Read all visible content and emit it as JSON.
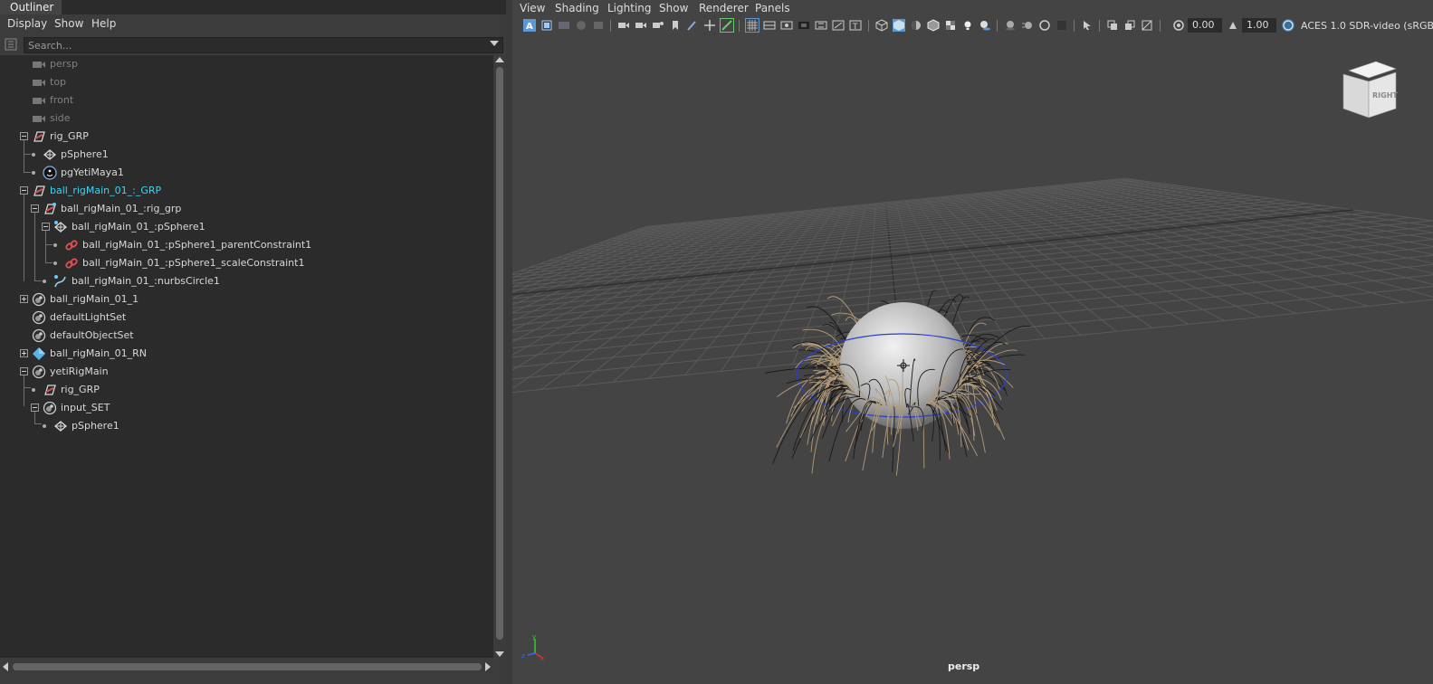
{
  "outliner": {
    "tab_label": "Outliner",
    "menus": [
      "Display",
      "Show",
      "Help"
    ],
    "search_placeholder": "Search...",
    "rows": [
      {
        "label": "persp",
        "icon": "camera-icon",
        "dim": true
      },
      {
        "label": "top",
        "icon": "camera-icon",
        "dim": true
      },
      {
        "label": "front",
        "icon": "camera-icon",
        "dim": true
      },
      {
        "label": "side",
        "icon": "camera-icon",
        "dim": true
      },
      {
        "label": "rig_GRP",
        "icon": "transform-group-icon"
      },
      {
        "label": "pSphere1",
        "icon": "mesh-icon"
      },
      {
        "label": "pgYetiMaya1",
        "icon": "yeti-node-icon"
      },
      {
        "label": "ball_rigMain_01_:_GRP",
        "icon": "transform-group-icon",
        "selected": true
      },
      {
        "label": "ball_rigMain_01_:rig_grp",
        "icon": "referenced-group-icon"
      },
      {
        "label": "ball_rigMain_01_:pSphere1",
        "icon": "mesh-icon"
      },
      {
        "label": "ball_rigMain_01_:pSphere1_parentConstraint1",
        "icon": "constraint-icon"
      },
      {
        "label": "ball_rigMain_01_:pSphere1_scaleConstraint1",
        "icon": "constraint-icon"
      },
      {
        "label": "ball_rigMain_01_:nurbsCircle1",
        "icon": "nurbs-curve-icon"
      },
      {
        "label": "ball_rigMain_01_1",
        "icon": "set-icon"
      },
      {
        "label": "defaultLightSet",
        "icon": "set-icon"
      },
      {
        "label": "defaultObjectSet",
        "icon": "set-icon"
      },
      {
        "label": "ball_rigMain_01_RN",
        "icon": "reference-node-icon"
      },
      {
        "label": "yetiRigMain",
        "icon": "set-icon"
      },
      {
        "label": "rig_GRP",
        "icon": "transform-group-icon"
      },
      {
        "label": "input_SET",
        "icon": "set-icon"
      },
      {
        "label": "pSphere1",
        "icon": "mesh-icon"
      }
    ]
  },
  "viewport": {
    "menus": [
      "View",
      "Shading",
      "Lighting",
      "Show",
      "Renderer",
      "Panels"
    ],
    "exposure": "0.00",
    "gamma": "1.00",
    "color_space": "ACES 1.0 SDR-video (sRGB",
    "camera_label": "persp",
    "viewcube_label": "RIGHT"
  },
  "colors": {
    "selected_text": "#3fd3f0",
    "panel_bg": "#444444",
    "tree_bg": "#2b2b2b",
    "grid_line": "#565656",
    "hair": "#b49b78"
  }
}
